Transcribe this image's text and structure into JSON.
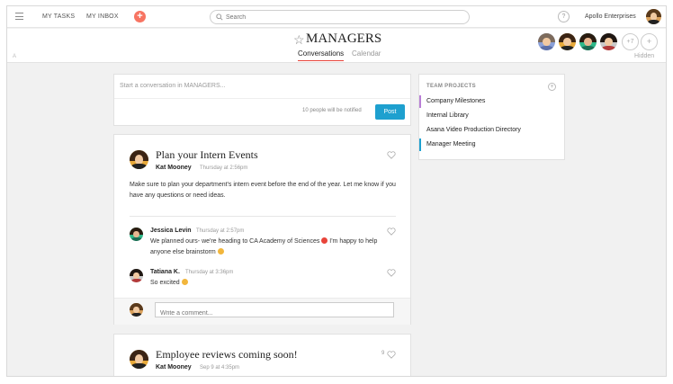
{
  "topbar": {
    "my_tasks": "MY TASKS",
    "my_inbox": "MY INBOX",
    "add": "+",
    "search_placeholder": "Search",
    "help": "?",
    "org_name": "Apollo Enterprises"
  },
  "header": {
    "title": "MANAGERS",
    "tabs": [
      {
        "label": "Conversations",
        "active": true
      },
      {
        "label": "Calendar",
        "active": false
      }
    ],
    "more_members": "+7",
    "add_member": "+",
    "hidden_label": "Hidden"
  },
  "compose": {
    "placeholder": "Start a conversation in MANAGERS...",
    "notify_text": "10 people will be notified",
    "post_label": "Post"
  },
  "posts": [
    {
      "title": "Plan your Intern Events",
      "author": "Kat Mooney",
      "time": "Thursday at 2:56pm",
      "body": "Make sure to plan your department's intern event before the end of the year. Let me know if you have any questions or need ideas.",
      "comments": [
        {
          "author": "Jessica Levin",
          "time": "Thursday at 2:57pm",
          "text": "We planned ours- we're heading to CA Academy of Sciences",
          "text2": " I'm happy to help anyone else brainstorm"
        },
        {
          "author": "Tatiana K.",
          "time": "Thursday at 3:36pm",
          "text": "So excited"
        }
      ],
      "comment_placeholder": "Write a comment..."
    },
    {
      "title": "Employee reviews coming soon!",
      "author": "Kat Mooney",
      "time": "Sep 9 at 4:35pm",
      "likes": "9"
    }
  ],
  "team_projects": {
    "header": "TEAM PROJECTS",
    "add": "+",
    "items": [
      {
        "label": "Company Milestones",
        "color": "#b97fd6"
      },
      {
        "label": "Internal Library",
        "color": ""
      },
      {
        "label": "Asana Video Production Directory",
        "color": ""
      },
      {
        "label": "Manager Meeting",
        "color": "#1ea0cf"
      }
    ]
  },
  "colors": {
    "accent": "#e8443a",
    "post_button": "#1ea0cf",
    "add_button": "#f77462"
  }
}
